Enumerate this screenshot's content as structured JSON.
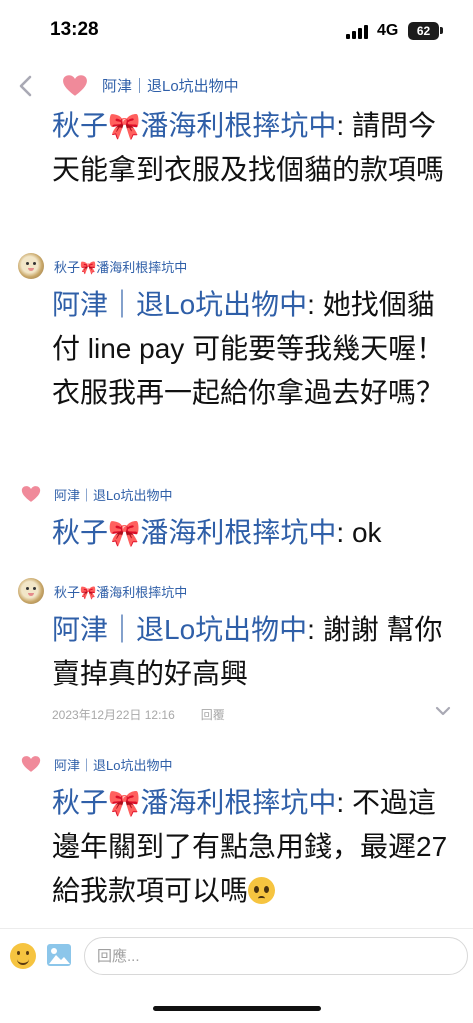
{
  "status_bar": {
    "time": "13:28",
    "network": "4G",
    "battery": "62"
  },
  "thread": {
    "header_sender": "阿津｜退Lo坑出物中"
  },
  "messages": [
    {
      "sender_label": "阿津｜退Lo坑出物中",
      "avatar": "heart-icon",
      "quoted_name_a": "秋子",
      "quoted_name_b": "潘海利根摔坑中",
      "text": ": 請問今天能拿到衣服及找個貓的款項嗎"
    },
    {
      "sender_label_a": "秋子",
      "sender_label_b": "潘海利根摔坑中",
      "avatar": "photo-avatar",
      "quoted_name": "阿津｜退Lo坑出物中",
      "text": ": 她找個貓付 line pay 可能要等我幾天喔！衣服我再一起給你拿過去好嗎？"
    },
    {
      "sender_label": "阿津｜退Lo坑出物中",
      "avatar": "heart-icon",
      "quoted_name_a": "秋子",
      "quoted_name_b": "潘海利根摔坑中",
      "text": ": ok"
    },
    {
      "sender_label_a": "秋子",
      "sender_label_b": "潘海利根摔坑中",
      "avatar": "photo-avatar",
      "quoted_name": "阿津｜退Lo坑出物中",
      "text": ": 謝謝 幫你賣掉真的好高興",
      "timestamp": "2023年12月22日 12:16",
      "reply_label": "回覆"
    },
    {
      "sender_label": "阿津｜退Lo坑出物中",
      "avatar": "heart-icon",
      "quoted_name_a": "秋子",
      "quoted_name_b": "潘海利根摔坑中",
      "text": ": 不過這邊年關到了有點急用錢，最遲27給我款項可以嗎",
      "emoji": "pleading-face-emoji"
    }
  ],
  "composer": {
    "placeholder": "回應..."
  },
  "colors": {
    "link_blue": "#2f5fa8",
    "heart_pink": "#f08a9a",
    "meta_gray": "#a8a8a8"
  }
}
